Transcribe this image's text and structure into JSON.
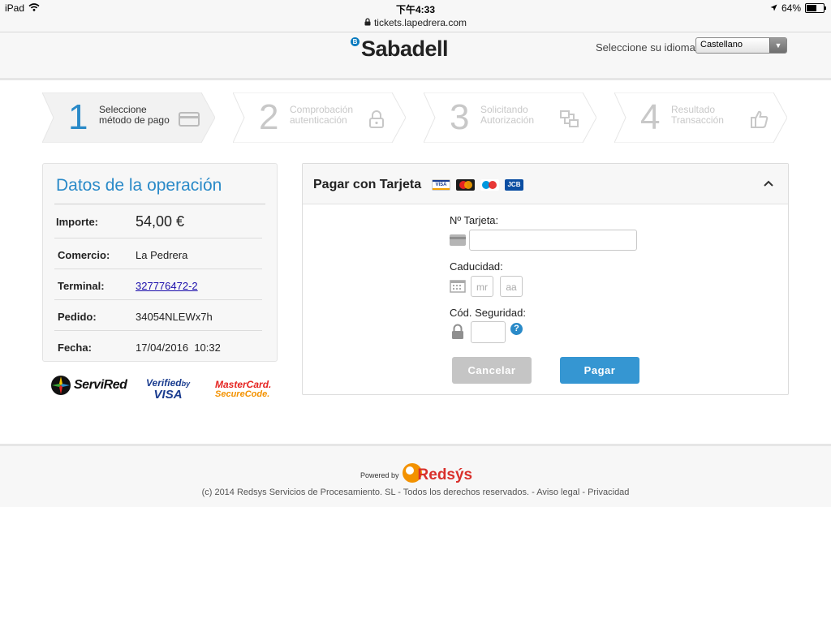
{
  "status_bar": {
    "device": "iPad",
    "time": "下午4:33",
    "battery": "64%",
    "battery_level": 0.64
  },
  "browser": {
    "url": "tickets.lapedrera.com"
  },
  "header": {
    "logo_letter": "B",
    "brand": "Sabadell",
    "language_label": "Seleccione su idioma",
    "language_value": "Castellano"
  },
  "steps": [
    {
      "num": "1",
      "line1": "Seleccione",
      "line2": "método de pago",
      "icon": "credit-card-icon",
      "active": true
    },
    {
      "num": "2",
      "line1": "Comprobación",
      "line2": "autenticación",
      "icon": "lock-icon",
      "active": false
    },
    {
      "num": "3",
      "line1": "Solicitando",
      "line2": "Autorización",
      "icon": "transfer-icon",
      "active": false
    },
    {
      "num": "4",
      "line1": "Resultado",
      "line2": "Transacción",
      "icon": "thumbs-up-icon",
      "active": false
    }
  ],
  "operation": {
    "title": "Datos de la operación",
    "amount_label": "Importe:",
    "amount": "54,00 €",
    "merchant_label": "Comercio:",
    "merchant": "La Pedrera",
    "terminal_label": "Terminal:",
    "terminal": "327776472-2",
    "order_label": "Pedido:",
    "order": "34054NLEWx7h",
    "date_label": "Fecha:",
    "date": "17/04/2016",
    "time": "10:32"
  },
  "security_logos": {
    "servired": "ServiRed",
    "verified_line1": "Verified",
    "verified_by": "by",
    "verified_line2": "VISA",
    "mastercard_line1": "MasterCard.",
    "mastercard_line2": "SecureCode."
  },
  "payment": {
    "title": "Pagar con Tarjeta",
    "card_brands": [
      {
        "name": "visa",
        "label": "VISA",
        "color": "#1a3c8f"
      },
      {
        "name": "mastercard",
        "color": "#e52421"
      },
      {
        "name": "maestro",
        "color": "#0099df"
      },
      {
        "name": "jcb",
        "label": "JCB",
        "color": "#0b4ea2"
      }
    ],
    "card_number_label": "Nº Tarjeta:",
    "expiry_label": "Caducidad:",
    "month_placeholder": "mr",
    "year_placeholder": "aa",
    "cvv_label": "Cód. Seguridad:",
    "help_symbol": "?",
    "cancel_label": "Cancelar",
    "pay_label": "Pagar"
  },
  "footer": {
    "powered_by": "Powered by",
    "redsys": "Redsýs",
    "copyright": "(c) 2014 Redsys Servicios de Procesamiento. SL - Todos los derechos reservados. -",
    "legal": "Aviso legal",
    "sep": "-",
    "privacy": "Privacidad"
  },
  "colors": {
    "accent_blue": "#2a8ac8",
    "pay_button": "#3596d2",
    "cancel_button": "#c5c5c5",
    "redsys_orange": "#f39200",
    "redsys_red": "#d9302b"
  }
}
